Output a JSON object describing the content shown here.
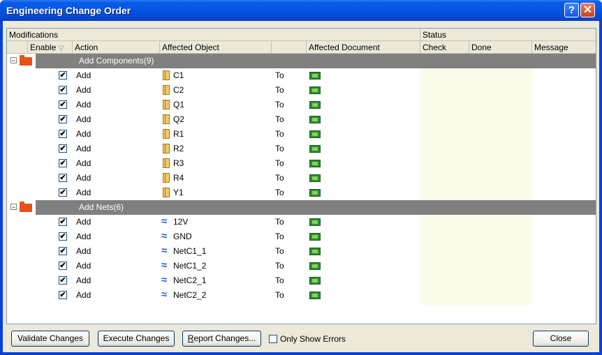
{
  "window": {
    "title": "Engineering Change Order",
    "help_glyph": "?",
    "close_glyph": "✕"
  },
  "header": {
    "group_modifications": "Modifications",
    "group_status": "Status",
    "col_enable": "Enable",
    "col_action": "Action",
    "col_affected_object": "Affected Object",
    "col_affected_document": "Affected Document",
    "col_check": "Check",
    "col_done": "Done",
    "col_message": "Message",
    "sort_glyph": "▽"
  },
  "groups": [
    {
      "label": "Add Components(9)",
      "expander": "−",
      "rows": [
        {
          "checked": "✔",
          "action": "Add",
          "object": "C1",
          "to": "To"
        },
        {
          "checked": "✔",
          "action": "Add",
          "object": "C2",
          "to": "To"
        },
        {
          "checked": "✔",
          "action": "Add",
          "object": "Q1",
          "to": "To"
        },
        {
          "checked": "✔",
          "action": "Add",
          "object": "Q2",
          "to": "To"
        },
        {
          "checked": "✔",
          "action": "Add",
          "object": "R1",
          "to": "To"
        },
        {
          "checked": "✔",
          "action": "Add",
          "object": "R2",
          "to": "To"
        },
        {
          "checked": "✔",
          "action": "Add",
          "object": "R3",
          "to": "To"
        },
        {
          "checked": "✔",
          "action": "Add",
          "object": "R4",
          "to": "To"
        },
        {
          "checked": "✔",
          "action": "Add",
          "object": "Y1",
          "to": "To"
        }
      ]
    },
    {
      "label": "Add Nets(6)",
      "expander": "−",
      "rows": [
        {
          "checked": "✔",
          "action": "Add",
          "object": "12V",
          "to": "To"
        },
        {
          "checked": "✔",
          "action": "Add",
          "object": "GND",
          "to": "To"
        },
        {
          "checked": "✔",
          "action": "Add",
          "object": "NetC1_1",
          "to": "To"
        },
        {
          "checked": "✔",
          "action": "Add",
          "object": "NetC1_2",
          "to": "To"
        },
        {
          "checked": "✔",
          "action": "Add",
          "object": "NetC2_1",
          "to": "To"
        },
        {
          "checked": "✔",
          "action": "Add",
          "object": "NetC2_2",
          "to": "To"
        }
      ]
    }
  ],
  "icons": {
    "component": "component-icon",
    "net": "net-icon",
    "document": "pcb-document-icon",
    "net_glyph": "≈"
  },
  "footer": {
    "validate": "Validate Changes",
    "execute": "Execute Changes",
    "report_first": "R",
    "report_rest": "eport Changes...",
    "only_errors": "Only Show Errors",
    "close": "Close"
  }
}
